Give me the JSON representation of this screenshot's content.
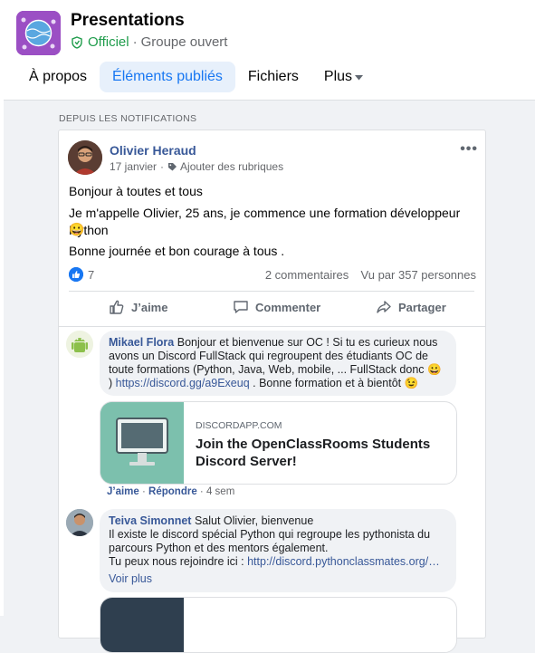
{
  "header": {
    "title": "Presentations",
    "official": "Officiel",
    "separator": "·",
    "group_type": "Groupe ouvert",
    "tabs": [
      {
        "label": "À propos"
      },
      {
        "label": "Éléments publiés",
        "active": true
      },
      {
        "label": "Fichiers"
      },
      {
        "label": "Plus"
      }
    ]
  },
  "section_label": "DEPUIS LES NOTIFICATIONS",
  "post": {
    "author": "Olivier Heraud",
    "date": "17 janvier",
    "meta_sep": "·",
    "add_topics": "Ajouter des rubriques",
    "lines": [
      "Bonjour à toutes et tous",
      "Je m'appelle Olivier, 25 ans, je commence une formation développeur Python",
      "😀",
      "Bonne journée et bon courage à tous ."
    ],
    "like_count": "7",
    "comments_count": "2 commentaires",
    "seen_by": "Vu par 357 personnes",
    "actions": {
      "like": "J’aime",
      "comment": "Commenter",
      "share": "Partager"
    }
  },
  "comments": [
    {
      "author": "Mikael Flora",
      "text": "Bonjour et bienvenue sur OC ! Si tu es curieux nous avons un Discord FullStack qui regroupent des étudiants OC de toute formations (Python, Java, Web, mobile, ... FullStack donc 😀 )",
      "link": "https://discord.gg/a9Exeuq",
      "text_after": " . Bonne formation et à bientôt 😉",
      "preview_domain": "DISCORDAPP.COM",
      "preview_title": "Join the OpenClassRooms Students Discord Server!",
      "like": "J’aime",
      "reply": "Répondre",
      "time": "4 sem"
    },
    {
      "author": "Teiva Simonnet",
      "line1": "Salut Olivier, bienvenue",
      "line2": "Il existe le discord spécial Python qui regroupe les pythonista du parcours Python et des mentors également.",
      "line3": "Tu peux nous rejoindre ici : ",
      "link": "http://discord.pythonclassmates.org/…",
      "see_more": "Voir plus"
    }
  ],
  "colors": {
    "accent": "#1877f2",
    "official_green": "#1f9c4b",
    "link": "#385898"
  }
}
